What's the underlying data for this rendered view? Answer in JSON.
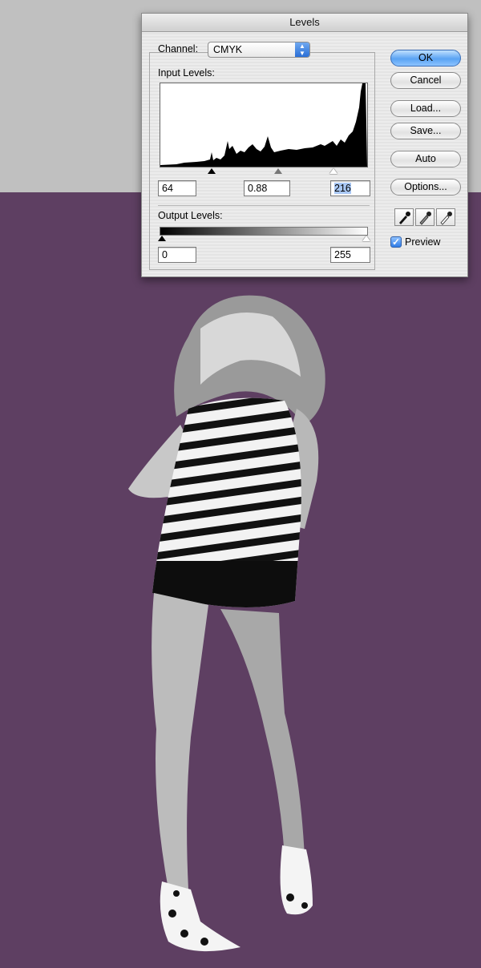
{
  "dialog": {
    "title": "Levels",
    "channel_label": "Channel:",
    "channel_value": "CMYK",
    "input_levels_label": "Input Levels:",
    "input_black": "64",
    "input_gamma": "0.88",
    "input_white": "216",
    "output_levels_label": "Output Levels:",
    "output_black": "0",
    "output_white": "255",
    "buttons": {
      "ok": "OK",
      "cancel": "Cancel",
      "load": "Load...",
      "save": "Save...",
      "auto": "Auto",
      "options": "Options..."
    },
    "preview_label": "Preview",
    "preview_checked": true,
    "accent_color": "#5aa3f3"
  },
  "canvas": {
    "background_top": "#c0c0c0",
    "background_main": "#5e3f62"
  }
}
